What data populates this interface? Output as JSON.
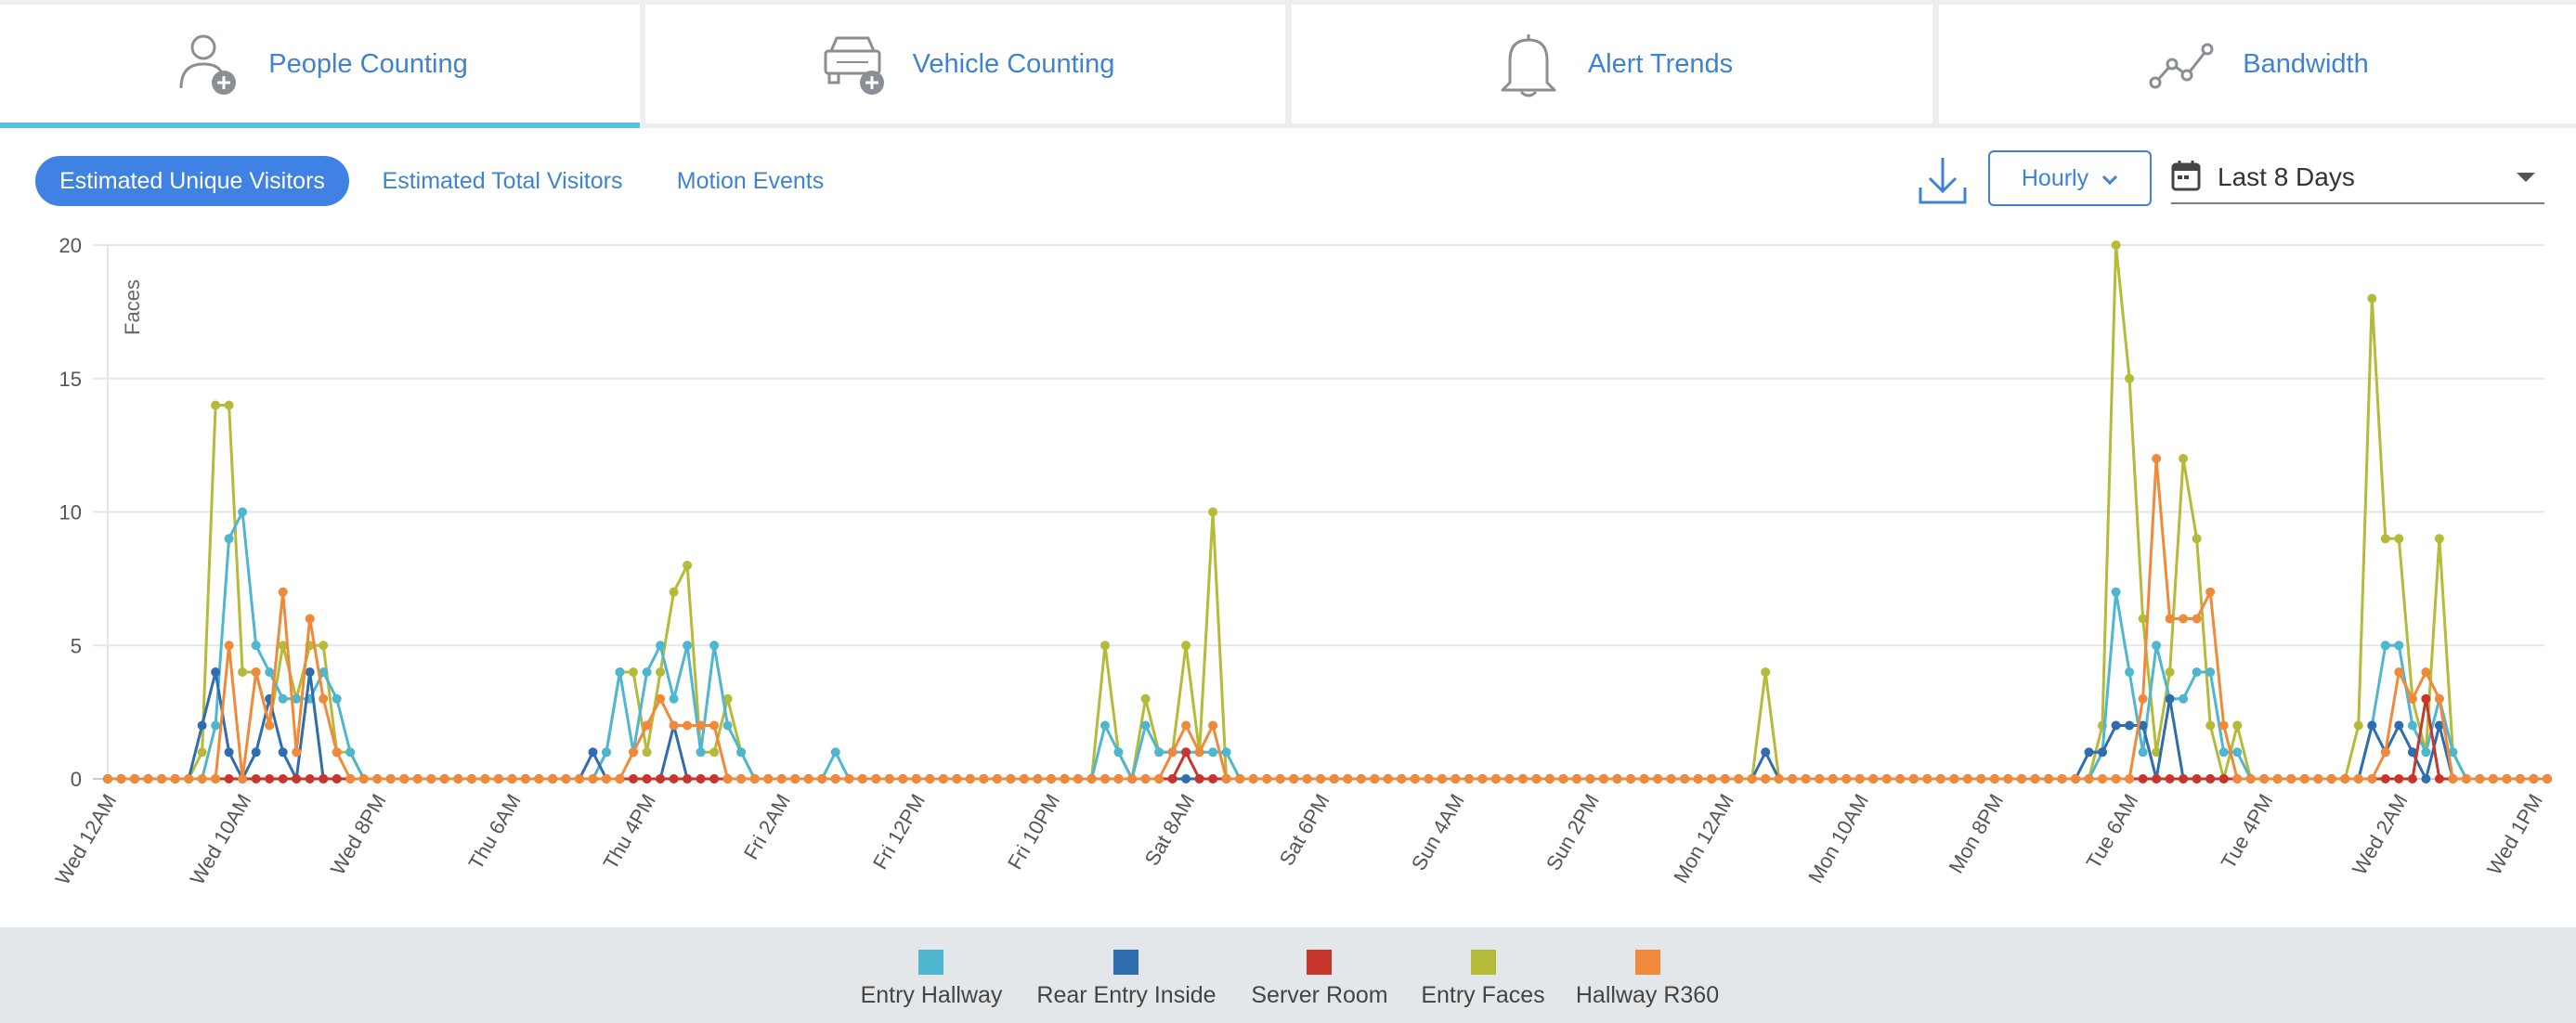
{
  "tabs": [
    {
      "label": "People Counting",
      "icon": "person-add-icon",
      "active": true
    },
    {
      "label": "Vehicle Counting",
      "icon": "car-add-icon",
      "active": false
    },
    {
      "label": "Alert Trends",
      "icon": "bell-icon",
      "active": false
    },
    {
      "label": "Bandwidth",
      "icon": "line-trend-icon",
      "active": false
    }
  ],
  "toolbar": {
    "segments": [
      {
        "label": "Estimated Unique Visitors",
        "selected": true
      },
      {
        "label": "Estimated Total Visitors",
        "selected": false
      },
      {
        "label": "Motion Events",
        "selected": false
      }
    ],
    "download_icon": "download-icon",
    "interval_selected": "Hourly",
    "date_range": "Last 8 Days",
    "calendar_icon": "calendar-icon"
  },
  "colors": {
    "accent": "#3f82e4",
    "tab_underline": "#5ac0db"
  },
  "chart_data": {
    "type": "line",
    "ylabel": "Faces",
    "ylim": [
      0,
      20
    ],
    "yticks": [
      0,
      5,
      10,
      15,
      20
    ],
    "x_tick_labels": [
      "Wed 12AM",
      "Wed 10AM",
      "Wed 8PM",
      "Thu 6AM",
      "Thu 4PM",
      "Fri 2AM",
      "Fri 12PM",
      "Fri 10PM",
      "Sat 8AM",
      "Sat 6PM",
      "Sun 4AM",
      "Sun 2PM",
      "Mon 12AM",
      "Mon 10AM",
      "Mon 8PM",
      "Tue 6AM",
      "Tue 4PM",
      "Wed 2AM",
      "Wed 1PM"
    ],
    "x_count": 182,
    "grid": "horizontal",
    "legend_position": "bottom",
    "series": [
      {
        "name": "Entry Hallway",
        "color": "#4eb6cf",
        "points": {
          "8": 2,
          "9": 9,
          "10": 10,
          "11": 5,
          "12": 4,
          "13": 3,
          "14": 3,
          "15": 3,
          "16": 4,
          "17": 3,
          "18": 1,
          "37": 1,
          "38": 4,
          "39": 1,
          "40": 4,
          "41": 5,
          "42": 3,
          "43": 5,
          "44": 1,
          "45": 5,
          "46": 2,
          "47": 1,
          "54": 1,
          "74": 2,
          "75": 1,
          "77": 2,
          "78": 1,
          "79": 1,
          "80": 1,
          "81": 1,
          "82": 1,
          "83": 1,
          "148": 1,
          "149": 7,
          "150": 4,
          "151": 1,
          "152": 5,
          "153": 3,
          "154": 3,
          "155": 4,
          "156": 4,
          "157": 1,
          "158": 1,
          "168": 2,
          "169": 5,
          "170": 5,
          "171": 2,
          "172": 1,
          "173": 3,
          "174": 1
        }
      },
      {
        "name": "Rear Entry Inside",
        "color": "#2f6daf",
        "points": {
          "7": 2,
          "8": 4,
          "9": 1,
          "10": 0,
          "11": 1,
          "12": 3,
          "13": 1,
          "14": 0,
          "15": 4,
          "36": 1,
          "41": 0,
          "42": 2,
          "43": 0,
          "44": 0,
          "45": 0,
          "123": 1,
          "147": 1,
          "148": 1,
          "149": 2,
          "150": 2,
          "151": 2,
          "152": 0,
          "153": 3,
          "154": 0,
          "167": 0,
          "168": 2,
          "169": 1,
          "170": 2,
          "171": 1,
          "172": 0,
          "173": 2,
          "174": 0
        }
      },
      {
        "name": "Server Room",
        "color": "#c8352b",
        "points": {
          "77": 0,
          "78": 0,
          "79": 0,
          "80": 1,
          "172": 3,
          "173": 0
        }
      },
      {
        "name": "Entry Faces",
        "color": "#b5bb38",
        "points": {
          "7": 1,
          "8": 14,
          "9": 14,
          "10": 4,
          "11": 4,
          "12": 2,
          "13": 5,
          "14": 3,
          "15": 5,
          "16": 5,
          "17": 1,
          "18": 1,
          "37": 1,
          "38": 4,
          "39": 4,
          "40": 1,
          "41": 4,
          "42": 7,
          "43": 8,
          "44": 1,
          "45": 1,
          "46": 3,
          "47": 1,
          "74": 5,
          "75": 1,
          "76": 0,
          "77": 3,
          "78": 1,
          "79": 1,
          "80": 5,
          "81": 1,
          "82": 10,
          "83": 0,
          "123": 4,
          "124": 0,
          "148": 2,
          "149": 20,
          "150": 15,
          "151": 6,
          "152": 1,
          "153": 4,
          "154": 12,
          "155": 9,
          "156": 2,
          "157": 0,
          "158": 2,
          "167": 2,
          "168": 18,
          "169": 9,
          "170": 9,
          "171": 3,
          "172": 1,
          "173": 9,
          "174": 1
        }
      },
      {
        "name": "Hallway R360",
        "color": "#f08a3a",
        "points": {
          "9": 5,
          "10": 0,
          "11": 4,
          "12": 2,
          "13": 7,
          "14": 1,
          "15": 6,
          "16": 3,
          "17": 1,
          "18": 0,
          "39": 1,
          "40": 2,
          "41": 3,
          "42": 2,
          "43": 2,
          "44": 2,
          "45": 2,
          "46": 0,
          "79": 1,
          "80": 2,
          "81": 1,
          "82": 2,
          "83": 0,
          "151": 3,
          "152": 12,
          "153": 6,
          "154": 6,
          "155": 6,
          "156": 7,
          "157": 2,
          "158": 0,
          "169": 1,
          "170": 4,
          "171": 3,
          "172": 4,
          "173": 3,
          "174": 0
        }
      }
    ]
  }
}
